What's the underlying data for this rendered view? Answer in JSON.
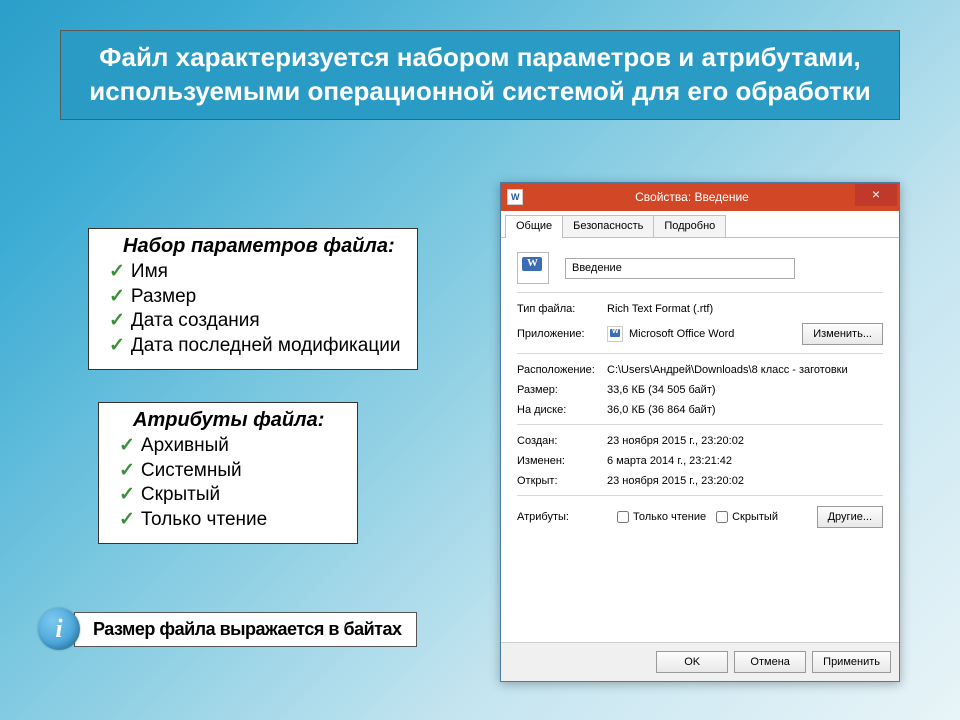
{
  "title": "Файл характеризуется набором параметров и атрибутами, используемыми операционной системой для его обработки",
  "params": {
    "heading": "Набор параметров файла:",
    "items": [
      "Имя",
      "Размер",
      "Дата создания",
      "Дата последней модификации"
    ]
  },
  "attrs": {
    "heading": "Атрибуты файла:",
    "items": [
      "Архивный",
      "Системный",
      "Скрытый",
      "Только чтение"
    ]
  },
  "note": {
    "icon": "i",
    "text": "Размер файла выражается в байтах"
  },
  "dialog": {
    "title": "Свойства: Введение",
    "close": "×",
    "tabs": {
      "general": "Общие",
      "security": "Безопасность",
      "details": "Подробно"
    },
    "filename": "Введение",
    "rows": {
      "type_label": "Тип файла:",
      "type_value": "Rich Text Format (.rtf)",
      "app_label": "Приложение:",
      "app_value": "Microsoft Office Word",
      "change_btn": "Изменить...",
      "loc_label": "Расположение:",
      "loc_value": "C:\\Users\\Андрей\\Downloads\\8 класс - заготовки",
      "size_label": "Размер:",
      "size_value": "33,6 КБ (34 505 байт)",
      "disk_label": "На диске:",
      "disk_value": "36,0 КБ (36 864 байт)",
      "created_label": "Создан:",
      "created_value": "23 ноября 2015 г., 23:20:02",
      "modified_label": "Изменен:",
      "modified_value": "6 марта 2014 г., 23:21:42",
      "opened_label": "Открыт:",
      "opened_value": "23 ноября 2015 г., 23:20:02",
      "attrs_label": "Атрибуты:",
      "readonly": "Только чтение",
      "hidden": "Скрытый",
      "other_btn": "Другие..."
    },
    "footer": {
      "ok": "OK",
      "cancel": "Отмена",
      "apply": "Применить"
    }
  }
}
